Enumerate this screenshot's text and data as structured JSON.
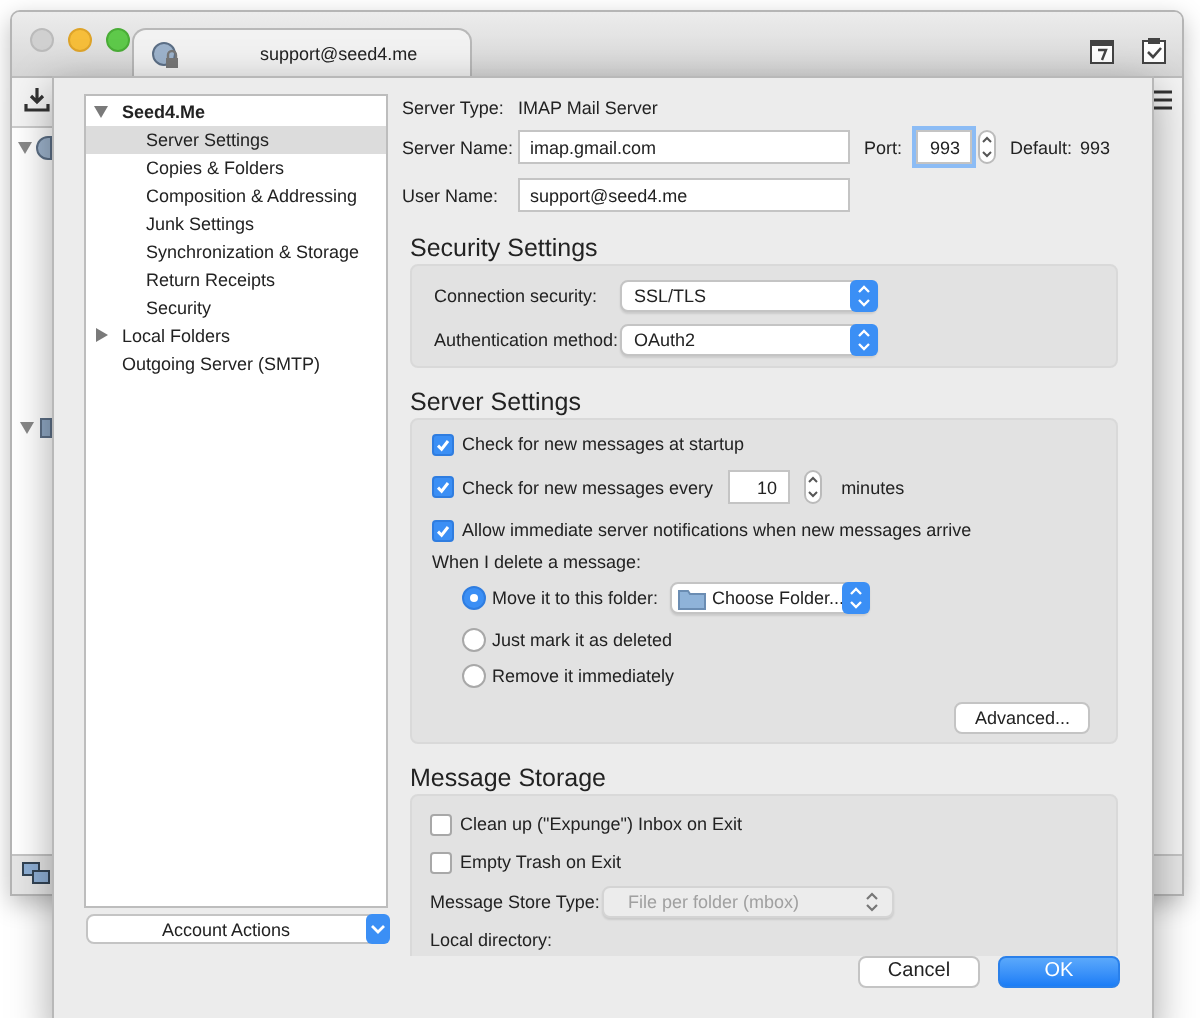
{
  "background_window": {
    "tab_title": "support@seed4.me"
  },
  "dialog": {
    "account_tree": [
      {
        "label": "Seed4.Me",
        "expanded": true,
        "selected": false,
        "children": [
          {
            "label": "Server Settings",
            "selected": true
          },
          {
            "label": "Copies & Folders",
            "selected": false
          },
          {
            "label": "Composition & Addressing",
            "selected": false
          },
          {
            "label": "Junk Settings",
            "selected": false
          },
          {
            "label": "Synchronization & Storage",
            "selected": false
          },
          {
            "label": "Return Receipts",
            "selected": false
          },
          {
            "label": "Security",
            "selected": false
          }
        ]
      },
      {
        "label": "Local Folders",
        "expanded": false,
        "selected": false
      },
      {
        "label": "Outgoing Server (SMTP)",
        "selected": false
      }
    ],
    "account_actions": "Account Actions",
    "server_type": {
      "label": "Server Type:",
      "value": "IMAP Mail Server"
    },
    "server_name": {
      "label": "Server Name:",
      "value": "imap.gmail.com"
    },
    "port": {
      "label": "Port:",
      "value": "993",
      "focused": true
    },
    "default_port": {
      "label": "Default:",
      "value": "993"
    },
    "user_name": {
      "label": "User Name:",
      "value": "support@seed4.me"
    },
    "security_settings": {
      "title": "Security Settings",
      "fields": [
        {
          "label": "Connection security:",
          "value": "SSL/TLS"
        },
        {
          "label": "Authentication method:",
          "value": "OAuth2"
        }
      ]
    },
    "server_settings": {
      "title": "Server Settings",
      "options": [
        {
          "kind": "checkbox",
          "label": "Check for new messages at startup",
          "checked": true
        },
        {
          "kind": "interval",
          "label": "Check for new messages every",
          "value": "10",
          "unit": "minutes",
          "checked": true
        },
        {
          "kind": "checkbox",
          "label": "Allow immediate server notifications when new messages arrive",
          "checked": true
        }
      ],
      "delete_label": "When I delete a message:",
      "delete_options": [
        {
          "label": "Move it to this folder:",
          "selected": true,
          "folder": "Choose Folder..."
        },
        {
          "label": "Just mark it as deleted",
          "selected": false
        },
        {
          "label": "Remove it immediately",
          "selected": false
        }
      ],
      "advanced_button": "Advanced..."
    },
    "message_storage": {
      "title": "Message Storage",
      "options": [
        {
          "label": "Clean up (\"Expunge\") Inbox on Exit",
          "checked": false
        },
        {
          "label": "Empty Trash on Exit",
          "checked": false
        }
      ],
      "store_type": {
        "label": "Message Store Type:",
        "value": "File per folder (mbox)",
        "disabled": true
      },
      "local_directory_label": "Local directory:"
    },
    "buttons": [
      {
        "label": "Cancel",
        "kind": "secondary"
      },
      {
        "label": "OK",
        "kind": "primary"
      }
    ]
  }
}
